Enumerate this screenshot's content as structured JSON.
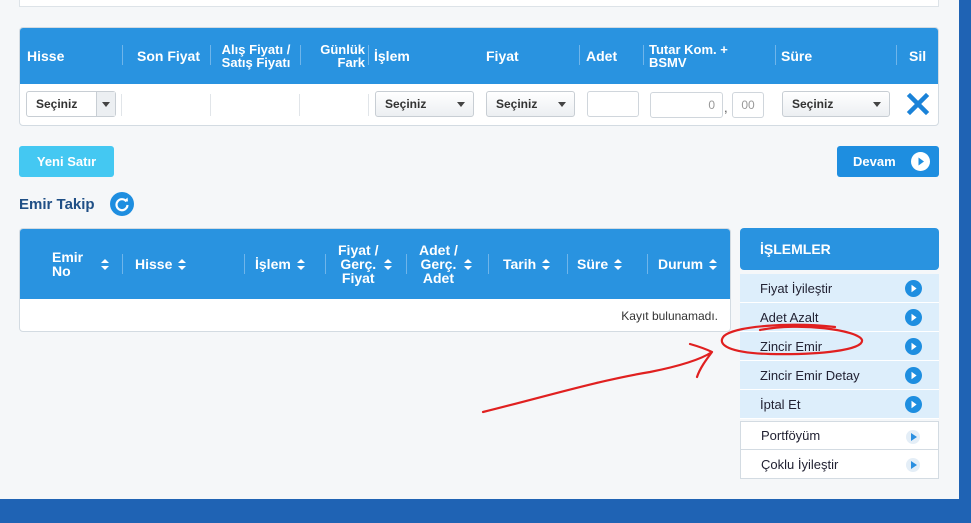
{
  "order_table": {
    "headers": [
      "Hisse",
      "Son Fiyat",
      "Alış Fiyatı /",
      "Satış Fiyatı",
      "Günlük",
      "Fark",
      "İşlem",
      "Fiyat",
      "Adet",
      "Tutar Kom. +",
      "BSMV",
      "Süre",
      "Sil"
    ],
    "row": {
      "hisse_select": "Seçiniz",
      "islem_select": "Seçiniz",
      "fiyat_select": "Seçiniz",
      "tutar_int_placeholder": "0",
      "tutar_sep": ",",
      "tutar_dec_placeholder": "00",
      "sure_select": "Seçiniz"
    }
  },
  "buttons": {
    "new_row": "Yeni Satır",
    "continue": "Devam"
  },
  "order_tracking": {
    "title": "Emir Takip",
    "headers": [
      "Emir",
      "No",
      "Hisse",
      "İşlem",
      "Fiyat /",
      "Gerç.",
      "Fiyat",
      "Adet /",
      "Gerç.",
      "Adet",
      "Tarih",
      "Süre",
      "Durum"
    ],
    "empty_message": "Kayıt bulunamadı."
  },
  "sidebar": {
    "title": "İŞLEMLER",
    "items": [
      {
        "label": "Fiyat İyileştir"
      },
      {
        "label": "Adet Azalt"
      },
      {
        "label": "Zincir Emir"
      },
      {
        "label": "Zincir Emir Detay"
      },
      {
        "label": "İptal Et"
      },
      {
        "label": "Portföyüm"
      },
      {
        "label": "Çoklu İyileştir"
      }
    ]
  },
  "colors": {
    "header_blue": "#2993e0",
    "accent_cyan": "#44c8f2",
    "annotation_red": "#e02020",
    "background": "#f5f7f9"
  },
  "icons": [
    "caret-down-icon",
    "close-x-icon",
    "play-circle-icon",
    "refresh-icon",
    "sort-icon"
  ]
}
